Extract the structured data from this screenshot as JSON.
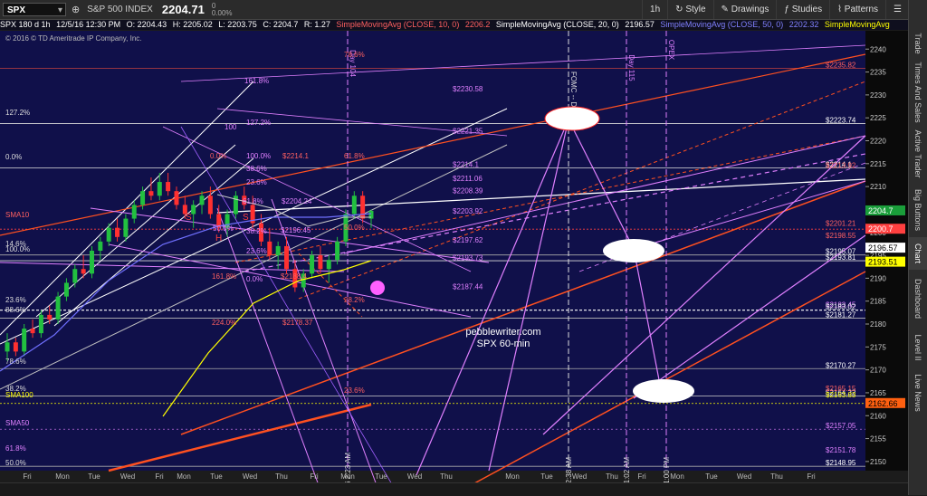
{
  "topbar": {
    "symbol": "SPX",
    "index_name": "S&P 500 INDEX",
    "last_price": "2204.71",
    "net_change": "0",
    "pct_change": "0.00%",
    "timeframe": "1h",
    "buttons": {
      "style": "Style",
      "drawings": "Drawings",
      "studies": "Studies",
      "patterns": "Patterns"
    }
  },
  "infobar": {
    "desc": "SPX 180 d 1h",
    "date": "12/5/16 12:30 PM",
    "open": "O: 2204.43",
    "high": "H: 2205.02",
    "low": "L: 2203.75",
    "close": "C: 2204.7",
    "range": "R: 1.27",
    "sma10": "SimpleMovingAvg (CLOSE, 10, 0)",
    "sma10_val": "2206.2",
    "sma20": "SimpleMovingAvg (CLOSE, 20, 0)",
    "sma20_val": "2196.57",
    "sma50": "SimpleMovingAvg (CLOSE, 50, 0)",
    "sma50_val": "2202.32",
    "sma100": "SimpleMovingAvg"
  },
  "sidebar_tabs": [
    "Trade",
    "Times And Sales",
    "Active Trader",
    "Big Buttons",
    "Chart",
    "Dashboard",
    "Level II",
    "Live News"
  ],
  "active_tab": "Chart",
  "chart_data": {
    "type": "candlestick",
    "copyright": "© 2016 © TD Ameritrade IP Company, Inc.",
    "watermark": [
      "pebblewriter.com",
      "SPX 60-min"
    ],
    "x_ticks": [
      "Fri",
      "Mon",
      "Tue",
      "Wed",
      "Fri",
      "Mon",
      "Tue",
      "Wed",
      "Thu",
      "Fri",
      "Mon",
      "Tue",
      "Wed",
      "Thu",
      "Mon",
      "Tue",
      "Wed",
      "Thu",
      "Fri",
      "Mon",
      "Tue",
      "Wed",
      "Thu",
      "Fri"
    ],
    "y_ticks": [
      2150,
      2155,
      2160,
      2165,
      2170,
      2175,
      2180,
      2185,
      2190,
      2195,
      2200,
      2205,
      2210,
      2215,
      2220,
      2225,
      2230,
      2235,
      2240
    ],
    "ylim": [
      2148,
      2244
    ],
    "candles": [
      [
        2174,
        2178,
        2172,
        2176
      ],
      [
        2176,
        2177,
        2173,
        2174
      ],
      [
        2174,
        2180,
        2173,
        2179
      ],
      [
        2179,
        2181,
        2177,
        2178
      ],
      [
        2178,
        2183,
        2177,
        2182
      ],
      [
        2182,
        2184,
        2180,
        2181
      ],
      [
        2181,
        2187,
        2180,
        2186
      ],
      [
        2186,
        2190,
        2185,
        2189
      ],
      [
        2189,
        2193,
        2188,
        2192
      ],
      [
        2192,
        2195,
        2190,
        2191
      ],
      [
        2191,
        2197,
        2190,
        2196
      ],
      [
        2196,
        2199,
        2194,
        2198
      ],
      [
        2198,
        2202,
        2197,
        2201
      ],
      [
        2201,
        2203,
        2198,
        2199
      ],
      [
        2199,
        2204,
        2198,
        2203
      ],
      [
        2203,
        2207,
        2202,
        2206
      ],
      [
        2206,
        2210,
        2205,
        2209
      ],
      [
        2209,
        2212,
        2207,
        2208
      ],
      [
        2208,
        2213,
        2207,
        2211
      ],
      [
        2211,
        2213,
        2208,
        2209
      ],
      [
        2209,
        2210,
        2205,
        2206
      ],
      [
        2206,
        2208,
        2203,
        2204
      ],
      [
        2204,
        2207,
        2201,
        2206
      ],
      [
        2206,
        2209,
        2204,
        2208
      ],
      [
        2208,
        2210,
        2203,
        2204
      ],
      [
        2204,
        2206,
        2200,
        2201
      ],
      [
        2201,
        2205,
        2199,
        2204
      ],
      [
        2204,
        2209,
        2203,
        2208
      ],
      [
        2208,
        2210,
        2205,
        2206
      ],
      [
        2206,
        2208,
        2201,
        2202
      ],
      [
        2202,
        2204,
        2197,
        2198
      ],
      [
        2198,
        2201,
        2194,
        2195
      ],
      [
        2195,
        2198,
        2192,
        2197
      ],
      [
        2197,
        2199,
        2191,
        2192
      ],
      [
        2192,
        2194,
        2187,
        2188
      ],
      [
        2188,
        2192,
        2187,
        2191
      ],
      [
        2191,
        2196,
        2190,
        2195
      ],
      [
        2195,
        2197,
        2191,
        2192
      ],
      [
        2192,
        2195,
        2189,
        2194
      ],
      [
        2194,
        2199,
        2193,
        2198
      ],
      [
        2198,
        2205,
        2197,
        2204
      ],
      [
        2204,
        2209,
        2203,
        2208
      ],
      [
        2208,
        2209,
        2202,
        2203
      ],
      [
        2203,
        2205,
        2201,
        2204.7
      ]
    ],
    "labels": [
      {
        "text": "161.8%",
        "x": 270,
        "y": 92,
        "color": "#e080ff"
      },
      {
        "text": "127.2%",
        "x": 6,
        "y": 127,
        "color": "#dddddd"
      },
      {
        "text": "127.2%",
        "x": 272,
        "y": 138,
        "color": "#e080ff"
      },
      {
        "text": "100",
        "x": 248,
        "y": 143,
        "color": "#e080ff"
      },
      {
        "text": "0.0%",
        "x": 6,
        "y": 176,
        "color": "#dddddd"
      },
      {
        "text": "100.0%",
        "x": 272,
        "y": 175,
        "color": "#e080ff"
      },
      {
        "text": "0.0%",
        "x": 232,
        "y": 175,
        "color": "#ff6060"
      },
      {
        "text": "$2214.1",
        "x": 312,
        "y": 175,
        "color": "#ff6060"
      },
      {
        "text": "61.8%",
        "x": 380,
        "y": 175,
        "color": "#ff6060"
      },
      {
        "text": "78.6%",
        "x": 380,
        "y": 63,
        "color": "#ff6060"
      },
      {
        "text": "38.6%",
        "x": 272,
        "y": 189,
        "color": "#e080ff"
      },
      {
        "text": "23.6%",
        "x": 272,
        "y": 204,
        "color": "#e080ff"
      },
      {
        "text": "61.8%",
        "x": 268,
        "y": 225,
        "color": "#e080ff"
      },
      {
        "text": "$2204.24",
        "x": 311,
        "y": 225,
        "color": "#e080ff"
      },
      {
        "text": "SMA10",
        "x": 6,
        "y": 240,
        "color": "#ff6060"
      },
      {
        "text": "38.2%",
        "x": 272,
        "y": 258,
        "color": "#e080ff"
      },
      {
        "text": "50.0%",
        "x": 235,
        "y": 255,
        "color": "#e080ff"
      },
      {
        "text": "50.0%",
        "x": 380,
        "y": 254,
        "color": "#ff6060"
      },
      {
        "text": "$2196.45",
        "x": 310,
        "y": 257,
        "color": "#e080ff"
      },
      {
        "text": "14.6%",
        "x": 6,
        "y": 272,
        "color": "#dddddd"
      },
      {
        "text": "100.0%",
        "x": 6,
        "y": 278,
        "color": "#dddddd"
      },
      {
        "text": "23.6%",
        "x": 272,
        "y": 280,
        "color": "#e080ff"
      },
      {
        "text": "161.8%",
        "x": 234,
        "y": 308,
        "color": "#ff6060"
      },
      {
        "text": "0.0%",
        "x": 272,
        "y": 311,
        "color": "#e080ff"
      },
      {
        "text": "$2188.4",
        "x": 310,
        "y": 308,
        "color": "#ff6060"
      },
      {
        "text": "28.2%",
        "x": 380,
        "y": 334,
        "color": "#ff6060"
      },
      {
        "text": "23.6%",
        "x": 6,
        "y": 334,
        "color": "#dddddd"
      },
      {
        "text": "88.6%",
        "x": 6,
        "y": 345,
        "color": "#dddddd"
      },
      {
        "text": "224.0%",
        "x": 234,
        "y": 359,
        "color": "#ff6060"
      },
      {
        "text": "$2178.37",
        "x": 312,
        "y": 359,
        "color": "#ff6060"
      },
      {
        "text": "78.6%",
        "x": 6,
        "y": 402,
        "color": "#dddddd"
      },
      {
        "text": "38.2%",
        "x": 6,
        "y": 432,
        "color": "#dddddd"
      },
      {
        "text": "SMA100",
        "x": 6,
        "y": 439,
        "color": "#ffff00"
      },
      {
        "text": "23.6%",
        "x": 380,
        "y": 434,
        "color": "#ff6060"
      },
      {
        "text": "SMA50",
        "x": 6,
        "y": 470,
        "color": "#e080ff"
      },
      {
        "text": "61.8%",
        "x": 6,
        "y": 498,
        "color": "#e080ff"
      },
      {
        "text": "50.0%",
        "x": 6,
        "y": 514,
        "color": "#dddddd"
      }
    ],
    "right_labels": [
      {
        "text": "$2235.82",
        "y": 2235.82,
        "color": "#ff6060"
      },
      {
        "text": "$2230.58",
        "y": 2230.58,
        "color": "#e080ff",
        "x": 500
      },
      {
        "text": "$2223.74",
        "y": 2223.74,
        "color": "#ffffff"
      },
      {
        "text": "$2221.35",
        "y": 2221.35,
        "color": "#e080ff",
        "x": 500
      },
      {
        "text": "$2214.1",
        "y": 2214.1,
        "color": "#ffffff"
      },
      {
        "text": "$2213.92",
        "y": 2213.92,
        "color": "#ff6060"
      },
      {
        "text": "$2214.1",
        "y": 2214.1,
        "color": "#e080ff",
        "x": 500
      },
      {
        "text": "$2211.06",
        "y": 2211.06,
        "color": "#e080ff",
        "x": 500
      },
      {
        "text": "$2208.39",
        "y": 2208.39,
        "color": "#e080ff",
        "x": 500
      },
      {
        "text": "$2203.92",
        "y": 2203.92,
        "color": "#e080ff",
        "x": 500
      },
      {
        "text": "$2201.21",
        "y": 2201.21,
        "color": "#ff6060"
      },
      {
        "text": "$2198.55",
        "y": 2198.55,
        "color": "#ff6060"
      },
      {
        "text": "$2197.62",
        "y": 2197.62,
        "color": "#e080ff",
        "x": 500
      },
      {
        "text": "$2195.07",
        "y": 2195.07,
        "color": "#ffffff"
      },
      {
        "text": "$2193.81",
        "y": 2193.81,
        "color": "#ffffff"
      },
      {
        "text": "$2193.73",
        "y": 2193.73,
        "color": "#e080ff",
        "x": 500
      },
      {
        "text": "$2187.44",
        "y": 2187.44,
        "color": "#e080ff",
        "x": 500
      },
      {
        "text": "$2183.45",
        "y": 2183.45,
        "color": "#e080ff"
      },
      {
        "text": "$2183.02",
        "y": 2183.02,
        "color": "#ffffff"
      },
      {
        "text": "$2181.27",
        "y": 2181.27,
        "color": "#ffffff"
      },
      {
        "text": "$2170.27",
        "y": 2170.27,
        "color": "#ffffff"
      },
      {
        "text": "$2164.32",
        "y": 2164.32,
        "color": "#ffffff"
      },
      {
        "text": "$2165.15",
        "y": 2165.15,
        "color": "#ff6060"
      },
      {
        "text": "$2163.83",
        "y": 2163.83,
        "color": "#ffff00"
      },
      {
        "text": "$2157.05",
        "y": 2157.05,
        "color": "#e080ff"
      },
      {
        "text": "$2151.78",
        "y": 2151.78,
        "color": "#e080ff"
      },
      {
        "text": "$2148.95",
        "y": 2148.95,
        "color": "#ffffff"
      }
    ],
    "price_tags": [
      {
        "text": "2204.7",
        "y": 2204.7,
        "bg": "#1a9e3a",
        "fg": "#ffffff"
      },
      {
        "text": "2200.7",
        "y": 2200.7,
        "bg": "#ff4040",
        "fg": "#ffffff"
      },
      {
        "text": "2196.57",
        "y": 2196.57,
        "bg": "#ffffff",
        "fg": "#000000"
      },
      {
        "text": "2193.51",
        "y": 2193.51,
        "bg": "#ffff00",
        "fg": "#000000"
      },
      {
        "text": "2162.66",
        "y": 2162.66,
        "bg": "#ff6010",
        "fg": "#000000"
      }
    ],
    "vlines": [
      {
        "text": "Day 104",
        "x": 384,
        "color": "#e080ff",
        "ty": 70
      },
      {
        "text": "FOMC -- Day 111",
        "x": 628,
        "color": "#dddddd",
        "ty": 110
      },
      {
        "text": "Day 115",
        "x": 692,
        "color": "#e080ff",
        "ty": 75
      },
      {
        "text": "OPEX",
        "x": 736,
        "color": "#e080ff",
        "ty": 55
      }
    ],
    "vline_dates": [
      {
        "text": "12/5/16 2:23 AM",
        "x": 384,
        "y": 500
      },
      {
        "text": "12/14/16 12:38 AM",
        "x": 628,
        "y": 505
      },
      {
        "text": "12/15/16 11:02 AM",
        "x": 692,
        "y": 505
      },
      {
        "text": "12/16/16 1:00 PM",
        "x": 736,
        "y": 505
      }
    ],
    "s_labels": [
      {
        "text": "S",
        "x": 205,
        "y": 243
      },
      {
        "text": "H",
        "x": 238,
        "y": 266
      },
      {
        "text": "S",
        "x": 268,
        "y": 243
      }
    ]
  }
}
